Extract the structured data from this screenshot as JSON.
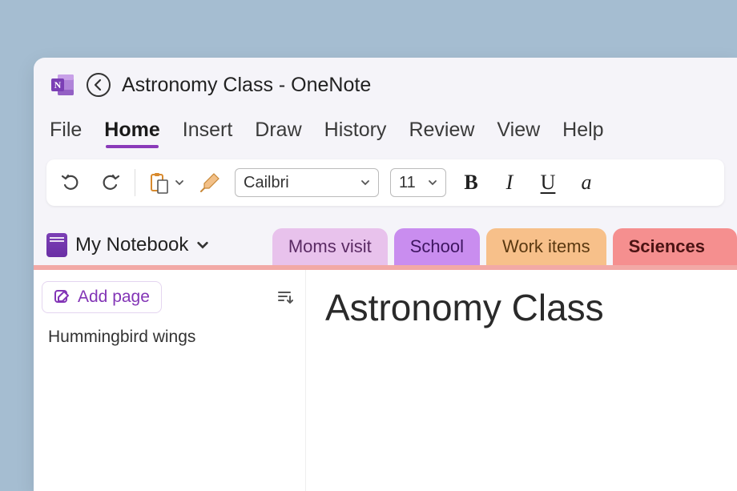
{
  "window": {
    "title": "Astronomy Class - OneNote"
  },
  "ribbon": {
    "tabs": [
      "File",
      "Home",
      "Insert",
      "Draw",
      "History",
      "Review",
      "View",
      "Help"
    ],
    "activeIndex": 1
  },
  "toolbar": {
    "font_name": "Cailbri",
    "font_size": "11"
  },
  "notebook": {
    "name": "My Notebook"
  },
  "sections": [
    {
      "label": "Moms visit",
      "class": "moms"
    },
    {
      "label": "School",
      "class": "school"
    },
    {
      "label": "Work items",
      "class": "work"
    },
    {
      "label": "Sciences",
      "class": "sciences"
    }
  ],
  "page_list": {
    "add_label": "Add page",
    "items": [
      "Hummingbird wings"
    ]
  },
  "page": {
    "title": "Astronomy Class"
  }
}
